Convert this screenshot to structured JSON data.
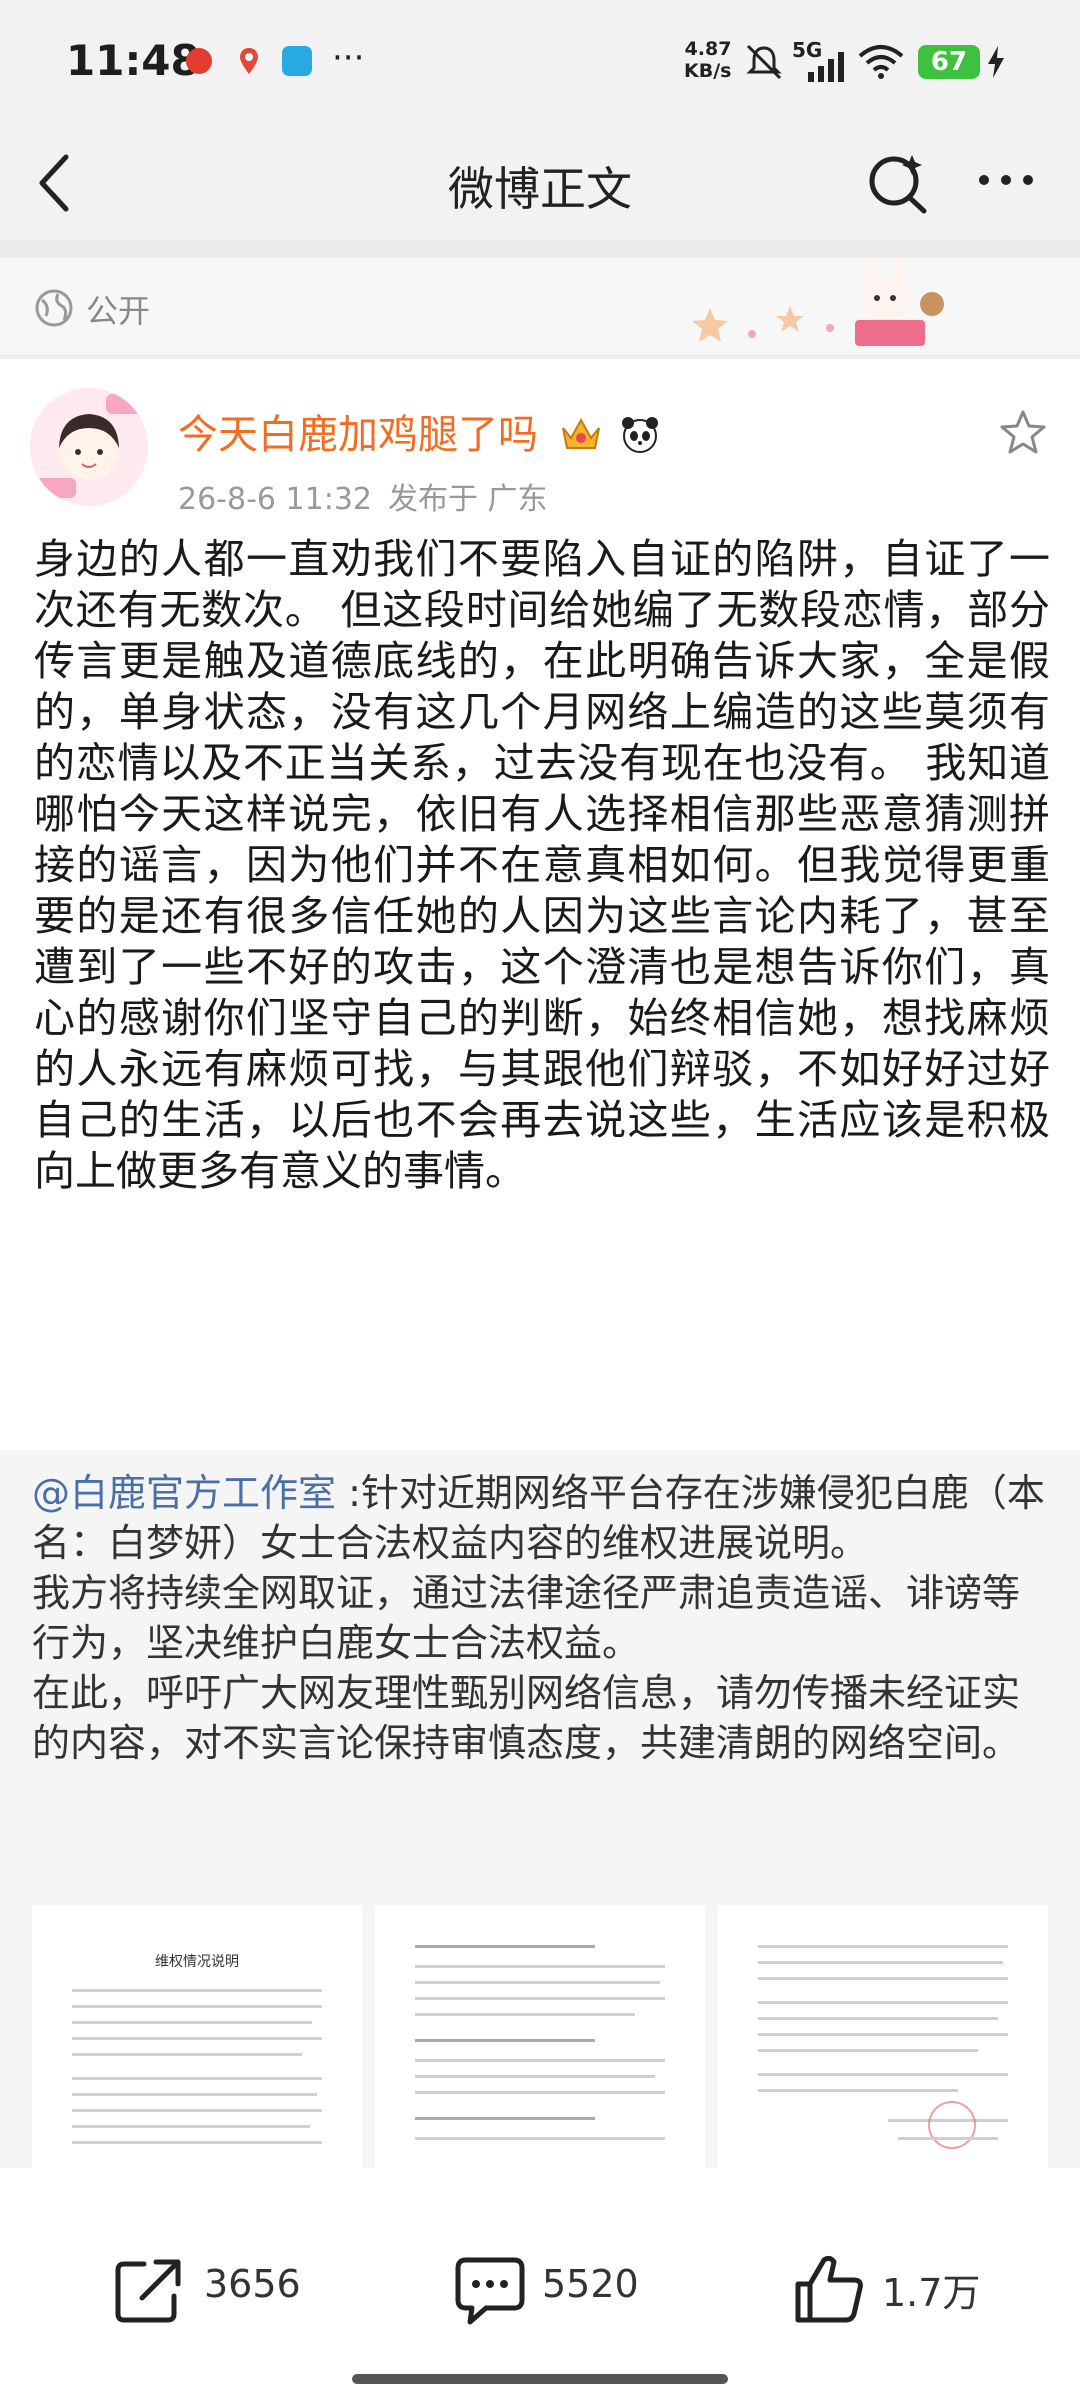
{
  "status_bar": {
    "time": "11:48",
    "net_speed_value": "4.87",
    "net_speed_unit": "KB/s",
    "network_type": "5G",
    "battery": "67"
  },
  "nav": {
    "title": "微博正文"
  },
  "visibility": {
    "label": "公开"
  },
  "post": {
    "author": "今天白鹿加鸡腿了吗",
    "time": "26-8-6 11:32",
    "location": "发布于 广东",
    "text": "身边的人都一直劝我们不要陷入自证的陷阱，自证了一次还有无数次。 但这段时间给她编了无数段恋情，部分传言更是触及道德底线的，在此明确告诉大家，全是假的，单身状态，没有这几个月网络上编造的这些莫须有的恋情以及不正当关系，过去没有现在也没有。 我知道哪怕今天这样说完，依旧有人选择相信那些恶意猜测拼接的谣言，因为他们并不在意真相如何。但我觉得更重要的是还有很多信任她的人因为这些言论内耗了，甚至遭到了一些不好的攻击，这个澄清也是想告诉你们，真心的感谢你们坚守自己的判断，始终相信她，想找麻烦的人永远有麻烦可找，与其跟他们辩驳，不如好好过好自己的生活，以后也不会再去说这些，生活应该是积极向上做更多有意义的事情。"
  },
  "repost": {
    "author": "@白鹿官方工作室",
    "line1": " :针对近期网络平台存在涉嫌侵犯白鹿（本名：白梦妍）女士合法权益内容的维权进展说明。",
    "line2": "我方将持续全网取证，通过法律途径严肃追责造谣、诽谤等行为，坚决维护白鹿女士合法权益。",
    "line3": "在此，呼吁广大网友理性甄别网络信息，请勿传播未经证实的内容，对不实言论保持审慎态度，共建清朗的网络空间。",
    "doc1_title": "维权情况说明"
  },
  "actions": {
    "share_count": "3656",
    "comment_count": "5520",
    "like_count": "1.7万"
  },
  "colors": {
    "author_name": "#f26d22",
    "link": "#4a6fa8",
    "battery": "#3ec13e"
  },
  "icons": [
    "weibo-icon",
    "location-pin-icon",
    "app-icon",
    "more-dots-icon",
    "mute-icon",
    "signal-icon",
    "wifi-icon",
    "charging-icon",
    "back-arrow-icon",
    "search-sparkle-icon",
    "more-icon",
    "globe-icon",
    "crown-badge-icon",
    "panda-icon",
    "star-icon",
    "share-icon",
    "comment-icon",
    "like-icon"
  ]
}
